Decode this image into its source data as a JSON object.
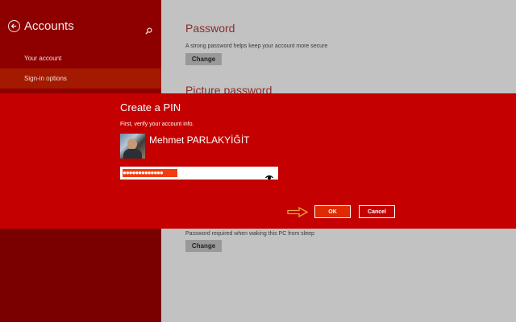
{
  "sidebar": {
    "title": "Accounts",
    "items": [
      {
        "label": "Your account"
      },
      {
        "label": "Sign-in options"
      }
    ]
  },
  "main": {
    "password_section": {
      "title": "Password",
      "description": "A strong password helps keep your account more secure",
      "button_label": "Change"
    },
    "picture_password_section": {
      "title": "Picture password"
    },
    "require_section": {
      "description": "Password required when waking this PC from sleep",
      "button_label": "Change"
    }
  },
  "dialog": {
    "title": "Create a PIN",
    "subtitle": "First, verify your account info.",
    "username": "Mehmet PARLAKYİĞİT",
    "password_mask": "●●●●●●●●●●●●●",
    "ok_label": "OK",
    "cancel_label": "Cancel"
  },
  "icons": {
    "back": "back-arrow-icon",
    "search": "search-icon",
    "reveal": "eye-icon",
    "pointer": "arrow-right-icon"
  },
  "colors": {
    "dialog_bg": "#c40000",
    "sidebar_bg": "#8e0000",
    "sidebar_selected": "#a31a00",
    "ok_button": "#e02a00",
    "password_fill": "#f23c10",
    "arrow": "#e8a13a"
  }
}
